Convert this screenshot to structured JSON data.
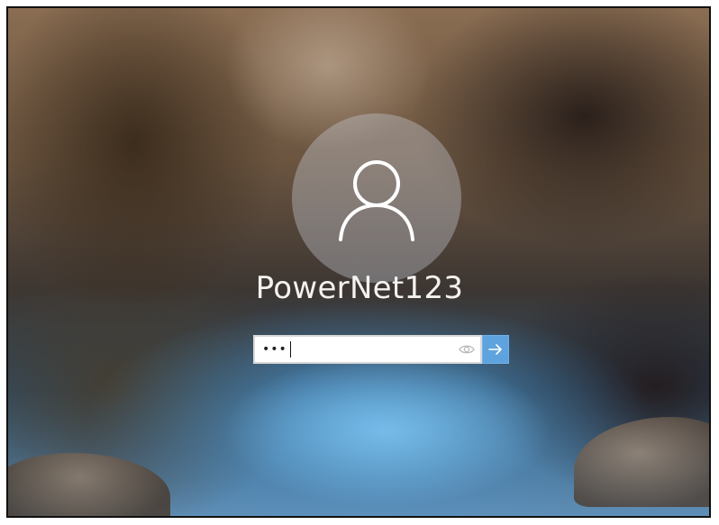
{
  "lock_screen": {
    "username": "PowerNet123",
    "password_field": {
      "masked_value": "•••"
    },
    "icons": {
      "avatar": "user-icon",
      "reveal": "eye-icon",
      "submit": "arrow-right-icon"
    },
    "colors": {
      "submit_button": "#5ea3de",
      "username_text": "#f4f2ef"
    }
  }
}
